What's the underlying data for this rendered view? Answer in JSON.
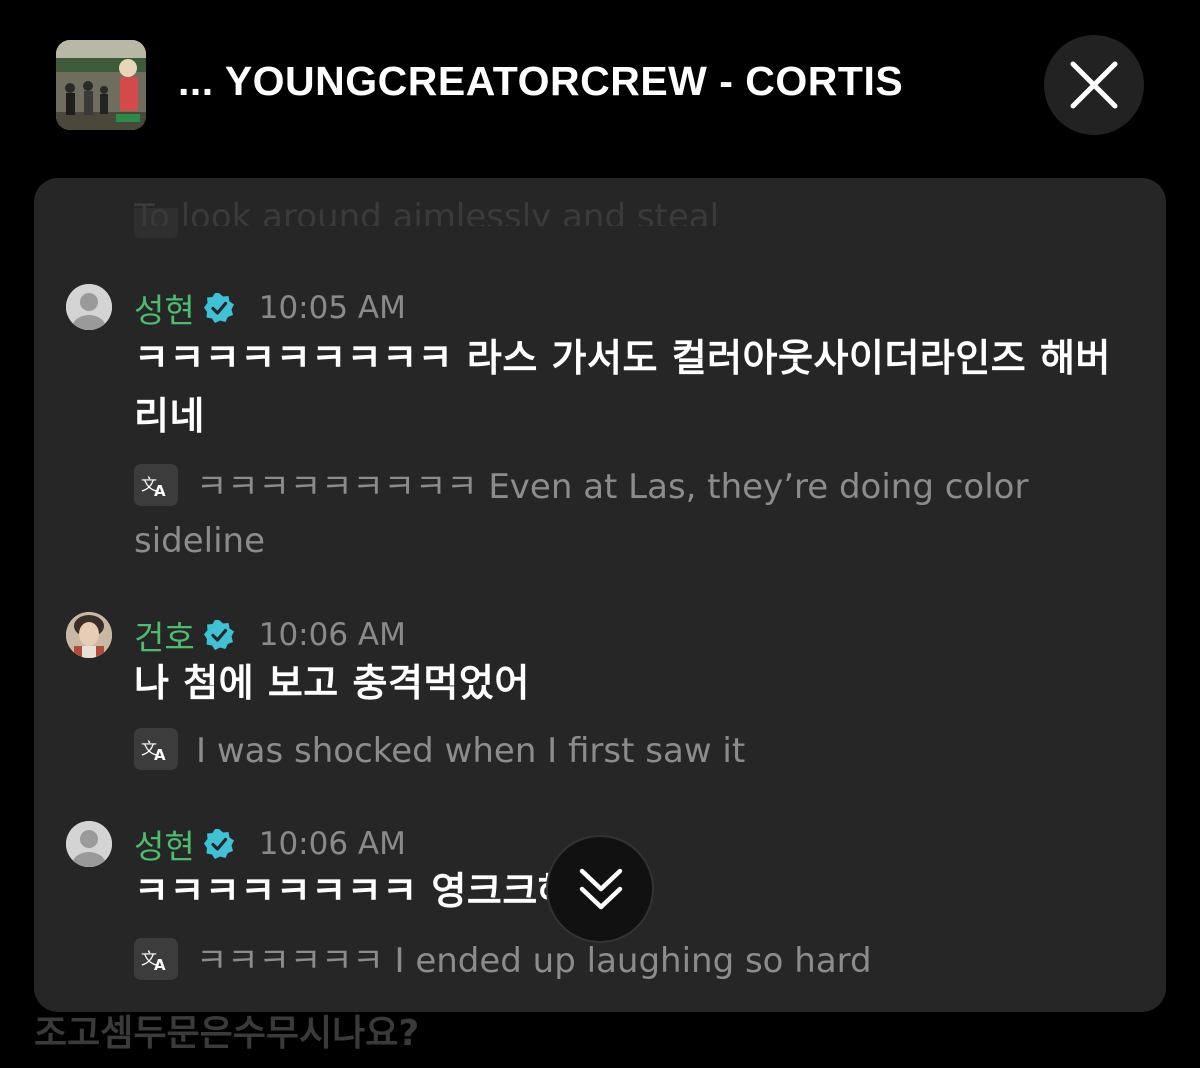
{
  "header": {
    "title": "... YOUNGCREATORCREW - CORTIS"
  },
  "ghost_top_text": "To look around aimlessly and steal",
  "messages": [
    {
      "name": "성현",
      "time": "10:05 AM",
      "text": "ㅋㅋㅋㅋㅋㅋㅋㅋㅋ 라스 가서도 컬러아웃사이더라인즈 해버리네",
      "translation": "ㅋㅋㅋㅋㅋㅋㅋㅋㅋ Even at Las, they’re doing color sideline"
    },
    {
      "name": "건호",
      "time": "10:06 AM",
      "text": "나 첨에 보고 충격먹었어",
      "translation": "I was shocked when I first saw it"
    },
    {
      "name": "성현",
      "time": "10:06 AM",
      "text": "ㅋㅋㅋㅋㅋㅋㅋㅋ 영크크해버림",
      "translation": "ㅋㅋㅋㅋㅋㅋ I ended up laughing so hard"
    }
  ],
  "behind_text": "조고셈두문은수무시나요?",
  "icons": {
    "thumbnail": "album-thumbnail",
    "close": "close-icon",
    "verified": "verified-badge-icon",
    "translate": "translate-icon",
    "scroll_down": "double-chevron-down-icon"
  },
  "colors": {
    "background": "#000000",
    "panel": "#262626",
    "name": "#4cbc6e",
    "verified": "#3fc2d6",
    "timestamp": "#8a8a8a",
    "translation": "#8c8c8c"
  }
}
